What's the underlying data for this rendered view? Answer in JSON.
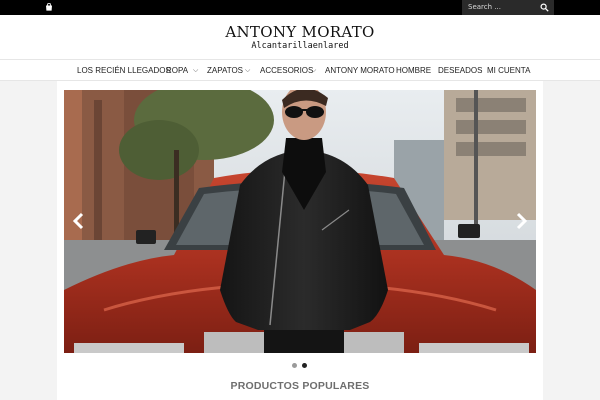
{
  "topbar": {
    "cart_icon": "shopping-bag-icon",
    "search_placeholder": "Search ...",
    "search_icon": "search-icon"
  },
  "header": {
    "title": "ANTONY MORATO",
    "subtitle": "Alcantarillaenlared"
  },
  "nav": {
    "items": [
      {
        "label": "LOS RECIÉN LLEGADOS"
      },
      {
        "label": "ROPA",
        "has_submenu": true
      },
      {
        "label": "ZAPATOS",
        "has_submenu": true
      },
      {
        "label": "ACCESORIOS",
        "has_submenu": true
      },
      {
        "label": "ANTONY MORATO"
      },
      {
        "label": "HOMBRE"
      },
      {
        "label": "DESEADOS"
      },
      {
        "label": "MI CUENTA"
      }
    ],
    "caret_glyph": "⌵"
  },
  "slider": {
    "description_icon": "hero-slide-image",
    "slide_count": 2,
    "active_slide": 2,
    "prev_icon": "chevron-left-icon",
    "next_icon": "chevron-right-icon"
  },
  "sections": {
    "popular_title": "PRODUCTOS POPULARES"
  },
  "colors": {
    "topbar": "#000000",
    "search_bg": "#2a2a2a",
    "page_bg": "#f3f3f3",
    "section_title": "#6e6e6e",
    "dot_active": "#222222",
    "dot_inactive": "#9a9a9a"
  }
}
